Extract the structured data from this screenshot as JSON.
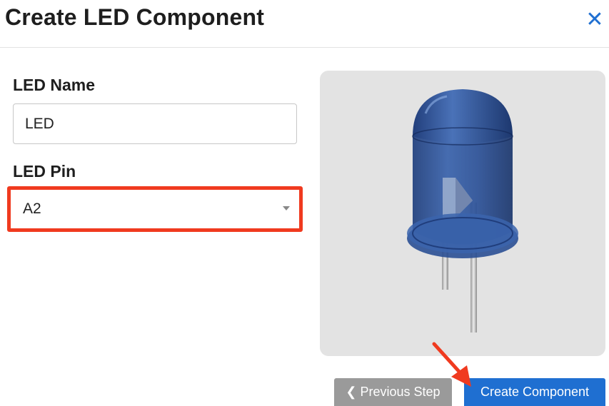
{
  "dialog": {
    "title": "Create LED Component",
    "close_icon": "close-icon",
    "close_glyph": "✕"
  },
  "form": {
    "name_label": "LED Name",
    "name_value": "LED",
    "pin_label": "LED Pin",
    "pin_value": "A2"
  },
  "preview": {
    "image_icon": "led-component-icon"
  },
  "footer": {
    "prev_label": "❮ Previous Step",
    "create_label": "Create Component"
  },
  "colors": {
    "accent": "#1f6fd1",
    "highlight": "#f03a1f",
    "secondary_button": "#9a9a9a",
    "led_blue": "#2a4f93"
  }
}
